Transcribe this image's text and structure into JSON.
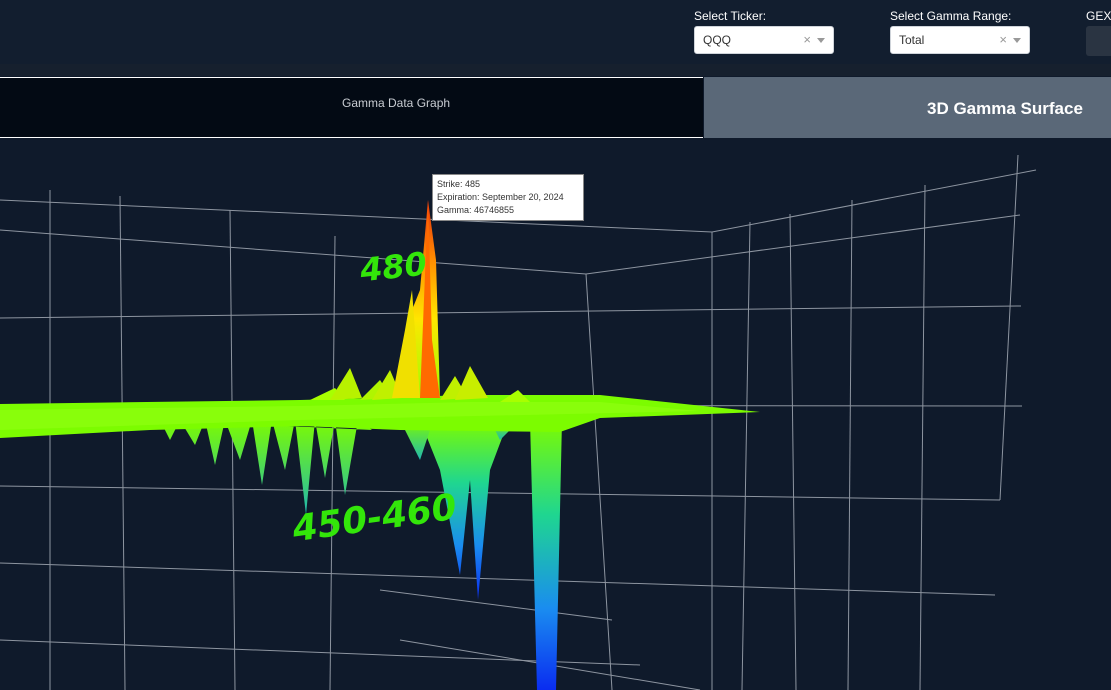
{
  "controls": {
    "ticker_label": "Select Ticker:",
    "ticker_value": "QQQ",
    "range_label": "Select Gamma Range:",
    "range_value": "Total",
    "gex_label": "GEX",
    "clear_glyph": "×"
  },
  "tabs": {
    "left": "Gamma Data Graph",
    "right": "3D Gamma Surface"
  },
  "tooltip": {
    "strike": "Strike: 485",
    "expiration": "Expiration: September 20, 2024",
    "gamma": "Gamma: 46746855"
  },
  "annotations": {
    "peak": "480",
    "trough": "450-460"
  },
  "colors": {
    "background": "#0f1a2b",
    "surface_flat": "#7cfc00",
    "peak": "#e8300f",
    "trough": "#0a2cf0",
    "handwriting": "#33e60a"
  }
}
